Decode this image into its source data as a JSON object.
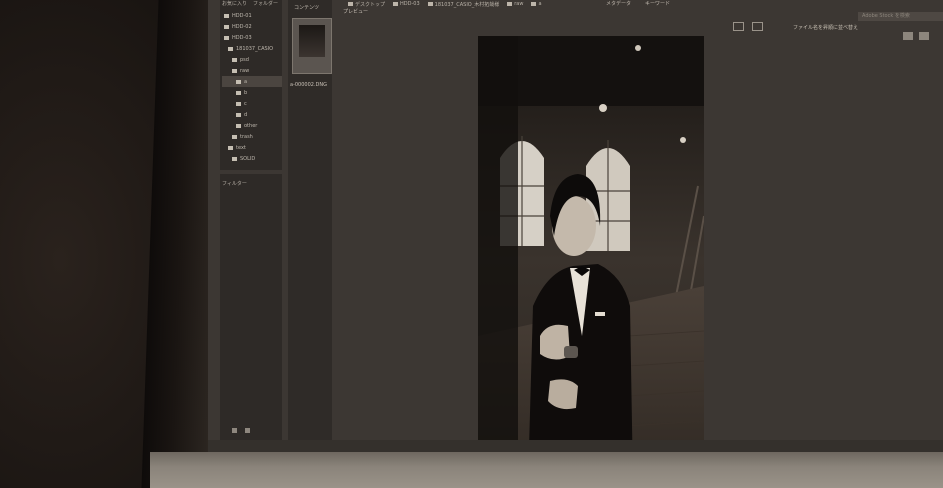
{
  "path": {
    "crumbs": [
      "デスクトップ",
      "HDD-03",
      "181037_CASIO_木村拓哉様",
      "raw",
      "a"
    ]
  },
  "top_menu": [
    "メタデータ",
    "キーワード"
  ],
  "search": {
    "placeholder": "Adobe Stock を検索"
  },
  "sort": {
    "label": "ファイル名を昇順に並べ替え"
  },
  "panels": {
    "favorites_tab": "お気に入り",
    "folders_tab": "フォルダー",
    "filter_tab": "フィルター",
    "content_tab": "コンテンツ",
    "preview_tab": "プレビュー"
  },
  "folder_tree": [
    {
      "label": "HDD-01",
      "depth": 0
    },
    {
      "label": "HDD-02",
      "depth": 0
    },
    {
      "label": "HDD-03",
      "depth": 0
    },
    {
      "label": "181037_CASIO",
      "depth": 1
    },
    {
      "label": "psd",
      "depth": 2
    },
    {
      "label": "raw",
      "depth": 2
    },
    {
      "label": "a",
      "depth": 3,
      "selected": true
    },
    {
      "label": "b",
      "depth": 3
    },
    {
      "label": "c",
      "depth": 3
    },
    {
      "label": "d",
      "depth": 3
    },
    {
      "label": "other",
      "depth": 3
    },
    {
      "label": "trash",
      "depth": 2
    },
    {
      "label": "text",
      "depth": 1
    },
    {
      "label": "SOLID",
      "depth": 2
    }
  ],
  "content": {
    "thumbnail_name": "a-000002.DNG"
  },
  "colors": {
    "screen_bg": "#3c3733",
    "panel_bg": "#2e2a27",
    "selection": "#4b4540"
  },
  "icons": [
    "folder-icon",
    "search-icon",
    "view-grid-icon",
    "view-list-icon",
    "rotate-icon",
    "filter-icon"
  ]
}
